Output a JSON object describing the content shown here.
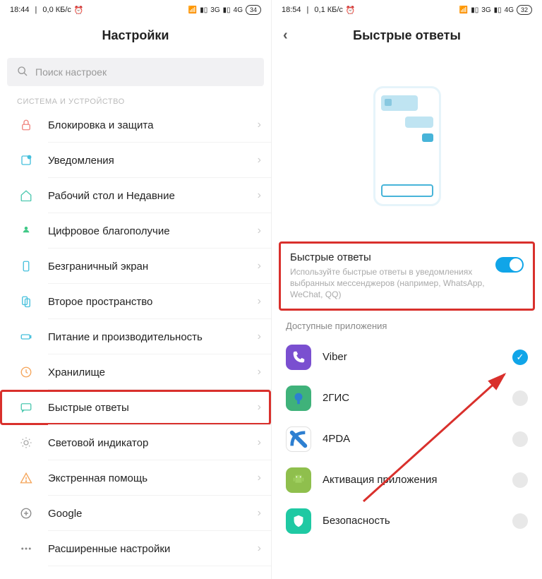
{
  "left": {
    "status": {
      "time": "18:44",
      "speed": "0,0 КБ/с",
      "net1": "3G",
      "net2": "4G",
      "battery": "34"
    },
    "title": "Настройки",
    "search_placeholder": "Поиск настроек",
    "section": "СИСТЕМА И УСТРОЙСТВО",
    "items": [
      {
        "label": "Блокировка и защита",
        "name": "lock"
      },
      {
        "label": "Уведомления",
        "name": "notifications"
      },
      {
        "label": "Рабочий стол и Недавние",
        "name": "home"
      },
      {
        "label": "Цифровое благополучие",
        "name": "wellbeing"
      },
      {
        "label": "Безграничный экран",
        "name": "fullscreen"
      },
      {
        "label": "Второе пространство",
        "name": "second-space"
      },
      {
        "label": "Питание и производительность",
        "name": "battery"
      },
      {
        "label": "Хранилище",
        "name": "storage"
      },
      {
        "label": "Быстрые ответы",
        "name": "quick-replies",
        "highlight": true
      },
      {
        "label": "Световой индикатор",
        "name": "led"
      },
      {
        "label": "Экстренная помощь",
        "name": "sos"
      },
      {
        "label": "Google",
        "name": "google"
      },
      {
        "label": "Расширенные настройки",
        "name": "advanced"
      }
    ]
  },
  "right": {
    "status": {
      "time": "18:54",
      "speed": "0,1 КБ/с",
      "net1": "3G",
      "net2": "4G",
      "battery": "32"
    },
    "title": "Быстрые ответы",
    "toggle": {
      "title": "Быстрые ответы",
      "desc": "Используйте быстрые ответы в уведомлениях выбранных мессенджеров (например, WhatsApp, WeChat, QQ)"
    },
    "available_label": "Доступные приложения",
    "apps": [
      {
        "label": "Viber",
        "name": "viber",
        "color": "#7a4fd0",
        "checked": true
      },
      {
        "label": "2ГИС",
        "name": "2gis",
        "color": "#3fb27a",
        "checked": false
      },
      {
        "label": "4PDA",
        "name": "4pda",
        "color": "#ffffff",
        "checked": false
      },
      {
        "label": "Активация приложения",
        "name": "activate",
        "color": "#8fbf4d",
        "checked": false
      },
      {
        "label": "Безопасность",
        "name": "security",
        "color": "#1fc9a3",
        "checked": false
      }
    ]
  }
}
